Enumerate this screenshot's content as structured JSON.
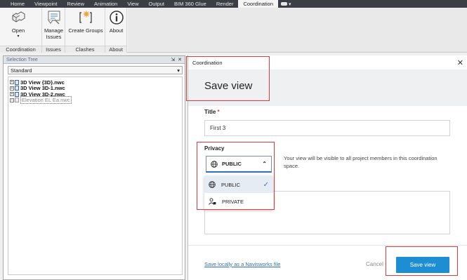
{
  "ribbon": {
    "tabs": [
      "Home",
      "Viewpoint",
      "Review",
      "Animation",
      "View",
      "Output",
      "BIM 360 Glue",
      "Render",
      "Coordination"
    ],
    "active_tab": "Coordination",
    "groups": {
      "coordination": {
        "label": "Coordination",
        "open_label": "Open"
      },
      "issues": {
        "label": "Issues",
        "manage_label": "Manage Issues"
      },
      "clashes": {
        "label": "Clashes",
        "create_groups_label": "Create Groups"
      },
      "about": {
        "label": "About",
        "about_label": "About"
      }
    }
  },
  "selection_tree": {
    "title": "Selection Tree",
    "dropdown_value": "Standard",
    "items": [
      "3D View {3D}.nwc",
      "3D View 3D-1.nwc",
      "3D View 3D-2.nwc",
      "Elevation EL Ea.nwc"
    ]
  },
  "coordination": {
    "header": "Coordination",
    "title": "Save view",
    "title_field_label": "Title",
    "title_value": "First 3",
    "privacy_label": "Privacy",
    "privacy_selected": "PUBLIC",
    "privacy_description": "Your view will be visible to all project members in this coordination space.",
    "privacy_options": [
      "PUBLIC",
      "PRIVATE"
    ],
    "save_locally_link": "Save locally as a Navisworks file",
    "cancel_label": "Cancel",
    "save_label": "Save view"
  },
  "colors": {
    "accent": "#1d8ed1",
    "highlight": "#e0393e"
  }
}
